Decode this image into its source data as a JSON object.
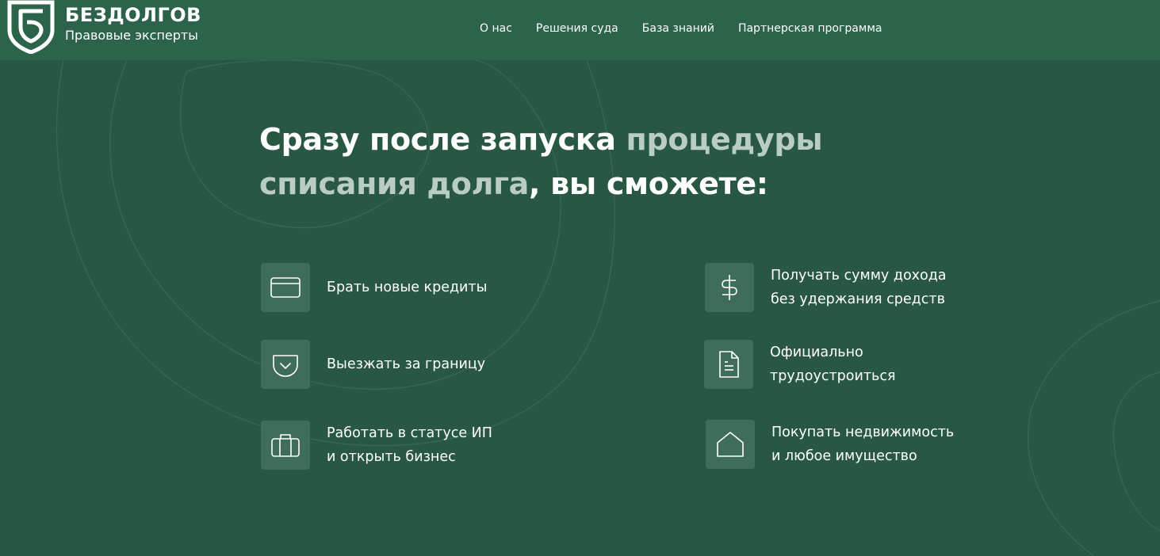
{
  "brand": {
    "name": "БЕЗДОЛГОВ",
    "tagline": "Правовые эксперты"
  },
  "nav": {
    "items": [
      "О нас",
      "Решения суда",
      "База знаний",
      "Партнерская программа"
    ]
  },
  "hero": {
    "title_part1": "Сразу после запуска ",
    "title_accent": "процедуры списания долга",
    "title_part2": ", вы сможете:"
  },
  "features": [
    {
      "icon": "credit-card-icon",
      "lines": [
        "Брать новые кредиты"
      ]
    },
    {
      "icon": "dollar-icon",
      "lines": [
        "Получать сумму дохода",
        "без удержания средств"
      ]
    },
    {
      "icon": "pocket-icon",
      "lines": [
        "Выезжать за границу"
      ]
    },
    {
      "icon": "document-icon",
      "lines": [
        "Официально",
        "трудоустроиться"
      ]
    },
    {
      "icon": "briefcase-icon",
      "lines": [
        "Работать в статусе ИП",
        "и открыть бизнес"
      ]
    },
    {
      "icon": "home-icon",
      "lines": [
        "Покупать недвижимость",
        "и любое имущество"
      ]
    }
  ],
  "colors": {
    "background": "#285843",
    "header": "#2b634b",
    "accent_text": "#b9cdc2",
    "icon_box": "#3e6d59"
  }
}
